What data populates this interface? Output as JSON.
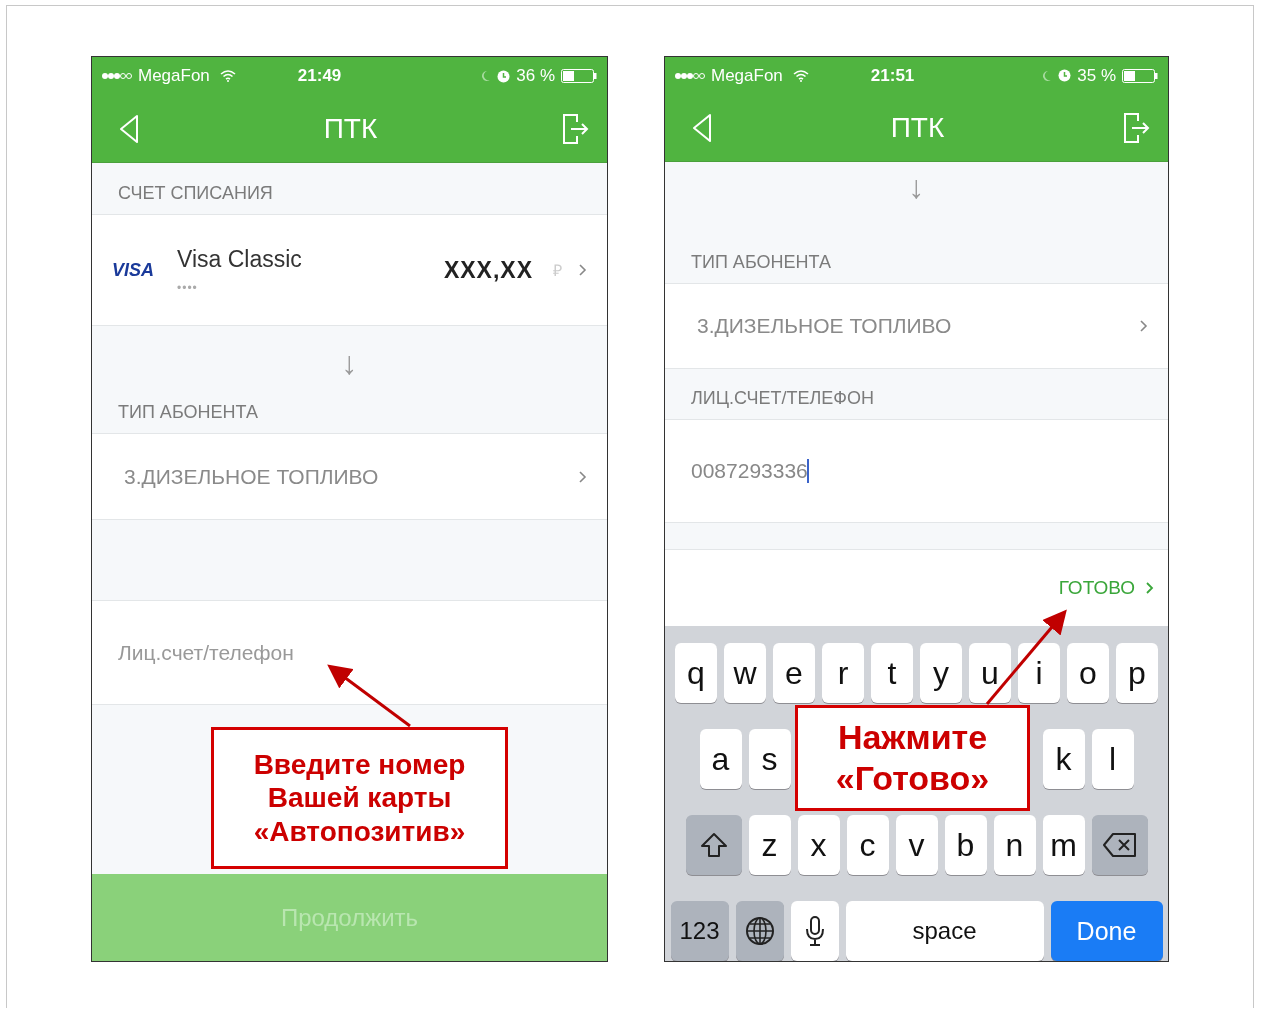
{
  "phones": [
    {
      "status_bar": {
        "carrier": "MegaFon",
        "time": "21:49",
        "battery": "36 %"
      },
      "nav": {
        "title": "ПТК"
      },
      "sections": [
        {
          "kind": "header",
          "text": "СЧЕТ СПИСАНИЯ"
        },
        {
          "kind": "card",
          "brand": "VISA",
          "name": "Visa Classic",
          "masked": "••••",
          "amount": "XXX,XX",
          "currency": "₽"
        },
        {
          "kind": "arrow",
          "glyph": "↓"
        },
        {
          "kind": "header",
          "text": "ТИП АБОНЕНТА"
        },
        {
          "kind": "select",
          "text": "3.ДИЗЕЛЬНОЕ ТОПЛИВО"
        },
        {
          "kind": "spacer"
        },
        {
          "kind": "input",
          "placeholder": "Лиц.счет/телефон"
        },
        {
          "kind": "fill"
        },
        {
          "kind": "button",
          "text": "Продолжить",
          "disabled": true
        }
      ],
      "callout": {
        "text": "Введите номер Вашей карты «Автопозитив»"
      }
    },
    {
      "status_bar": {
        "carrier": "MegaFon",
        "time": "21:51",
        "battery": "35 %"
      },
      "nav": {
        "title": "ПТК"
      },
      "sections": [
        {
          "kind": "arrow",
          "glyph": "↓"
        },
        {
          "kind": "header",
          "text": "ТИП АБОНЕНТА"
        },
        {
          "kind": "select",
          "text": "3.ДИЗЕЛЬНОЕ ТОПЛИВО"
        },
        {
          "kind": "header",
          "text": "ЛИЦ.СЧЕТ/ТЕЛЕФОН"
        },
        {
          "kind": "input",
          "value": "0087293336"
        },
        {
          "kind": "gap"
        },
        {
          "kind": "done_bar",
          "text": "ГОТОВО"
        },
        {
          "kind": "keyboard",
          "rows": [
            [
              "q",
              "w",
              "e",
              "r",
              "t",
              "y",
              "u",
              "i",
              "o",
              "p"
            ],
            [
              "a",
              "s",
              "k",
              "l"
            ],
            [
              "z",
              "x",
              "c",
              "v",
              "b",
              "n",
              "m"
            ]
          ],
          "numbers": "123",
          "space": "space",
          "done": "Done"
        }
      ],
      "callout": {
        "text": "Нажмите «Готово»"
      }
    }
  ]
}
